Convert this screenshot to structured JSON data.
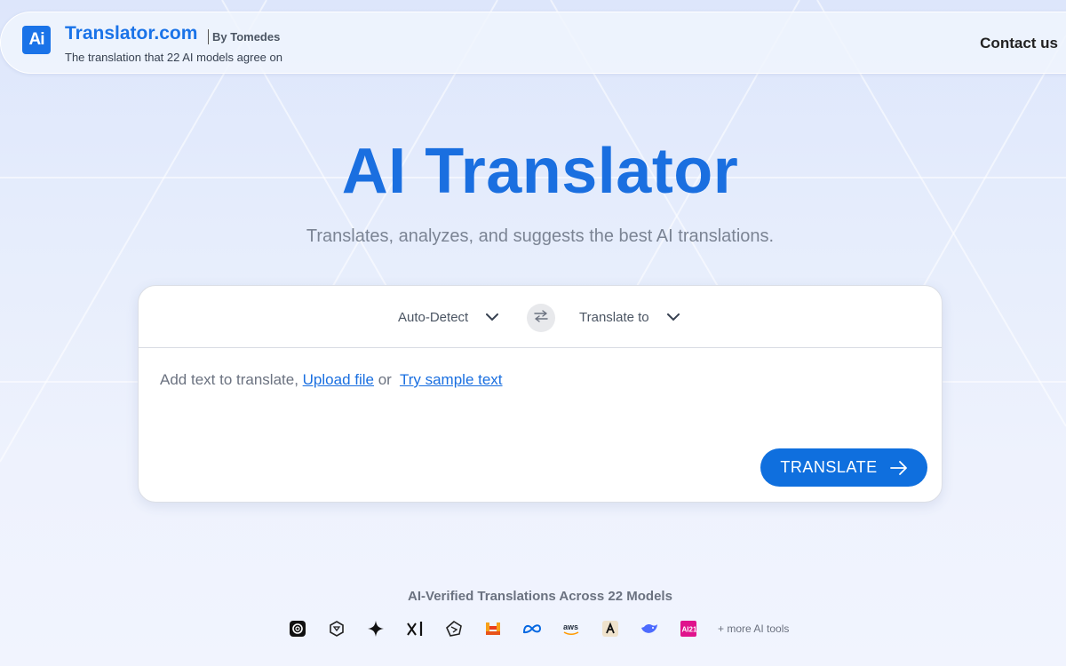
{
  "header": {
    "logo_text": "Ai",
    "brand": "Translator.com",
    "by": "By Tomedes",
    "tagline": "The translation that 22 AI models agree on",
    "contact": "Contact us"
  },
  "hero": {
    "title": "AI Translator",
    "subtitle": "Translates, analyzes, and suggests the best AI translations."
  },
  "translator": {
    "source_lang": "Auto-Detect",
    "target_lang": "Translate to",
    "prompt_text": "Add text to translate, ",
    "upload_link": "Upload file",
    "or_text": " or ",
    "sample_link": "Try sample text",
    "translate_button": "TRANSLATE"
  },
  "models": {
    "title": "AI-Verified Translations Across 22 Models",
    "icons": [
      "openai-icon",
      "perplexity-icon",
      "gemini-icon",
      "grok-icon",
      "qwen-icon",
      "mistral-icon",
      "meta-icon",
      "aws-icon",
      "anthropic-icon",
      "deepseek-icon",
      "ai21-icon"
    ],
    "more": "+ more AI tools"
  },
  "colors": {
    "accent": "#1a73e8",
    "button": "#0f6fde",
    "mistral": "#f7a11a",
    "meta": "#0668e1",
    "anthropic_bg": "#efe2cc",
    "deepseek": "#4d6bfe",
    "ai21": "#e0138c"
  }
}
